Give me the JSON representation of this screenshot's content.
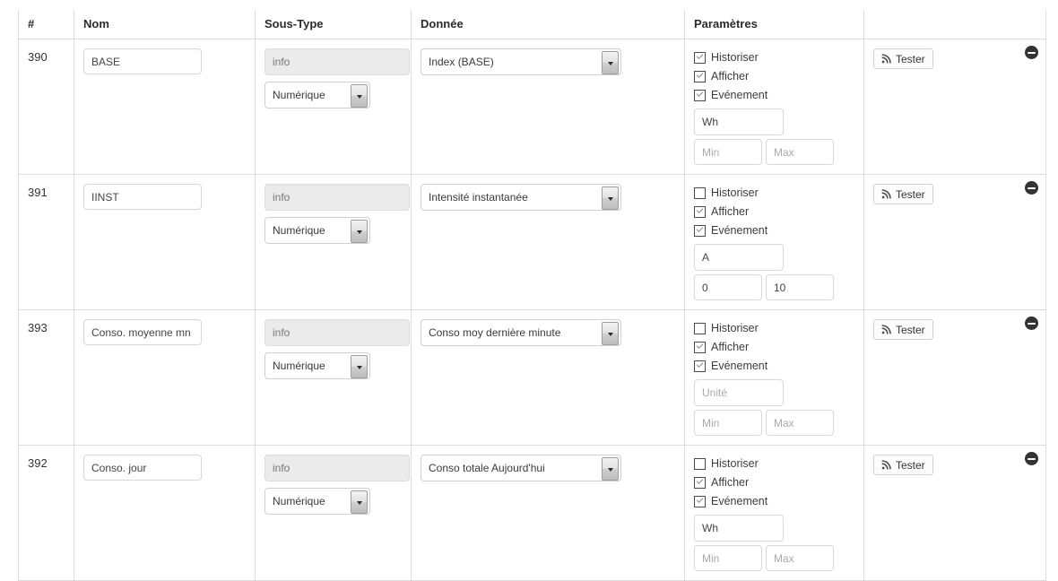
{
  "table": {
    "headers": {
      "id": "#",
      "nom": "Nom",
      "sous_type": "Sous-Type",
      "donnee": "Donnée",
      "parametres": "Paramètres",
      "actions": ""
    },
    "labels": {
      "historiser": "Historiser",
      "afficher": "Afficher",
      "evenement": "Evénement",
      "tester": "Tester",
      "remove": "Supprimer"
    },
    "placeholders": {
      "unite": "Unité",
      "min": "Min",
      "max": "Max",
      "nom": "",
      "info": ""
    },
    "icons": {
      "rss": "rss-icon",
      "remove": "minus-circle-icon",
      "dropdown": "chevron-down-icon"
    },
    "rows": [
      {
        "id": "390",
        "nom": "BASE",
        "type": "info",
        "sous_type": "Numérique",
        "donnee": "Index (BASE)",
        "historiser": true,
        "afficher": true,
        "evenement": true,
        "unite": "Wh",
        "min": "",
        "max": "",
        "tester": "Tester"
      },
      {
        "id": "391",
        "nom": "IINST",
        "type": "info",
        "sous_type": "Numérique",
        "donnee": "Intensité instantanée",
        "historiser": false,
        "afficher": true,
        "evenement": true,
        "unite": "A",
        "min": "0",
        "max": "10",
        "tester": "Tester"
      },
      {
        "id": "393",
        "nom": "Conso. moyenne mn",
        "type": "info",
        "sous_type": "Numérique",
        "donnee": "Conso moy dernière minute",
        "historiser": false,
        "afficher": true,
        "evenement": true,
        "unite": "",
        "min": "",
        "max": "",
        "tester": "Tester"
      },
      {
        "id": "392",
        "nom": "Conso. jour",
        "type": "info",
        "sous_type": "Numérique",
        "donnee": "Conso totale Aujourd'hui",
        "historiser": false,
        "afficher": true,
        "evenement": true,
        "unite": "Wh",
        "min": "",
        "max": "",
        "tester": "Tester"
      }
    ]
  },
  "colors": {
    "border": "#dddddd",
    "text": "#333333",
    "disabled_bg": "#ebebeb",
    "placeholder": "#a9a9a9",
    "remove_icon": "#333333"
  }
}
